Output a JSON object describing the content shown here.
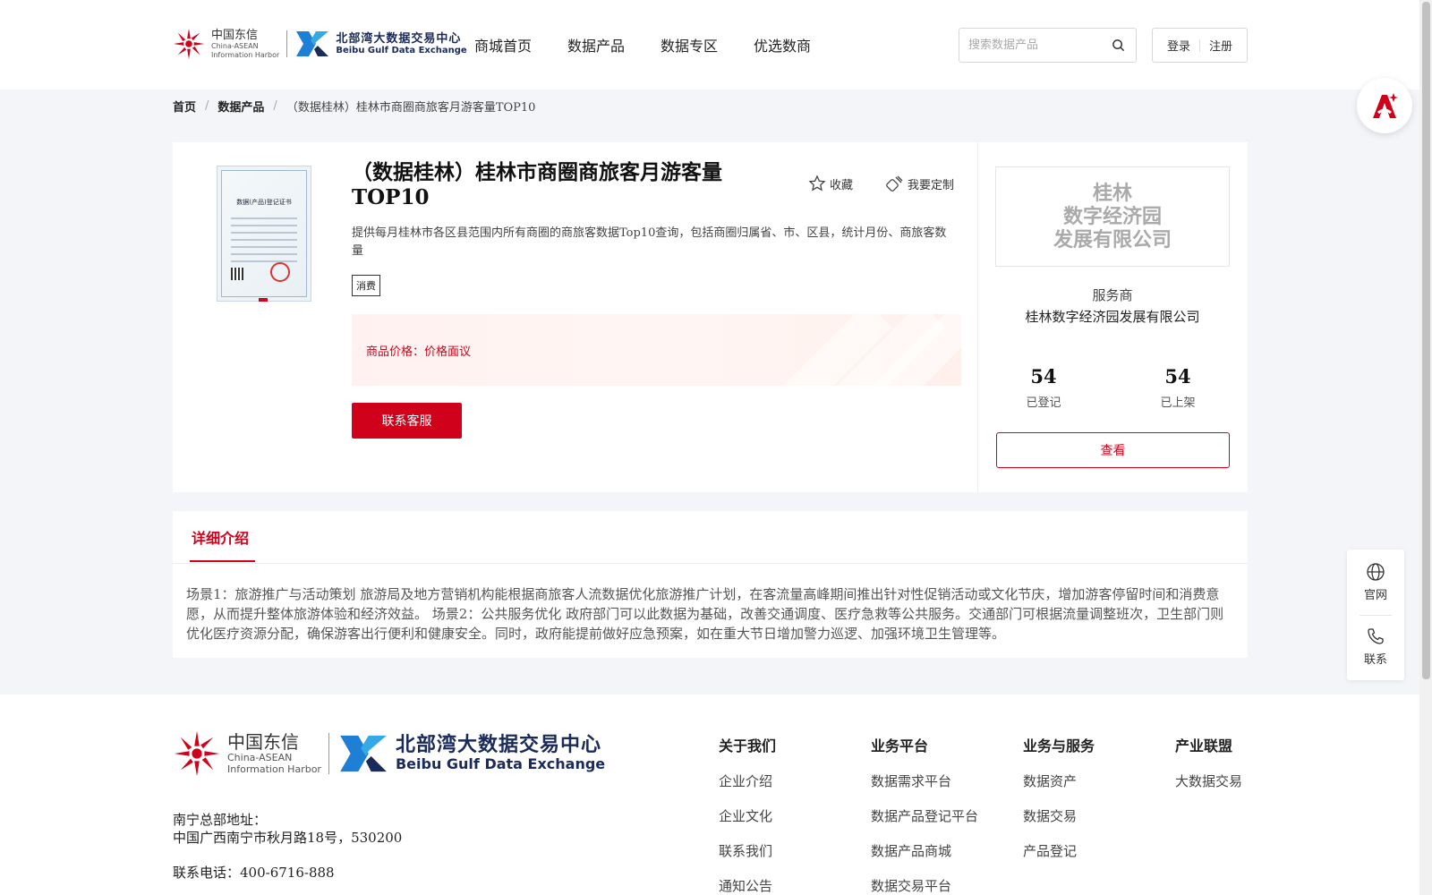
{
  "header": {
    "logo": {
      "cn": "中国东信",
      "en1": "China-ASEAN",
      "en2": "Information Harbor",
      "bb_cn": "北部湾大数据交易中心",
      "bb_en": "Beibu Gulf Data Exchange"
    },
    "nav": [
      "商城首页",
      "数据产品",
      "数据专区",
      "优选数商"
    ],
    "search_placeholder": "搜索数据产品",
    "login": "登录",
    "register": "注册"
  },
  "breadcrumb": {
    "home": "首页",
    "category": "数据产品",
    "current": "（数据桂林）桂林市商圈商旅客月游客量TOP10"
  },
  "product": {
    "title": "（数据桂林）桂林市商圈商旅客月游客量TOP10",
    "favorite": "收藏",
    "customize": "我要定制",
    "description": "提供每月桂林市各区县范围内所有商圈的商旅客数据Top10查询，包括商圈归属省、市、区县，统计月份、商旅客数量",
    "tag": "消费",
    "price_label": "商品价格：",
    "price_value": "价格面议",
    "contact_button": "联系客服",
    "certificate": {
      "title": "数据(产品)登记证书"
    }
  },
  "provider": {
    "logo_lines": [
      "桂林",
      "数字经济园",
      "发展有限公司"
    ],
    "label": "服务商",
    "name": "桂林数字经济园发展有限公司",
    "registered_count": "54",
    "registered_label": "已登记",
    "listed_count": "54",
    "listed_label": "已上架",
    "view_button": "查看"
  },
  "detail": {
    "tab": "详细介绍",
    "text": "场景1：旅游推广与活动策划 旅游局及地方营销机构能根据商旅客人流数据优化旅游推广计划，在客流量高峰期间推出针对性促销活动或文化节庆，增加游客停留时间和消费意愿，从而提升整体旅游体验和经济效益。 场景2：公共服务优化 政府部门可以此数据为基础，改善交通调度、医疗急救等公共服务。交通部门可根据流量调整班次，卫生部门则优化医疗资源分配，确保游客出行便利和健康安全。同时，政府能提前做好应急预案，如在重大节日增加警力巡逻、加强环境卫生管理等。"
  },
  "side_tools": {
    "website": "官网",
    "contact": "联系"
  },
  "footer": {
    "address_label": "南宁总部地址：",
    "address": "中国广西南宁市秋月路18号，530200",
    "phone": "联系电话：400-6716-888",
    "columns": [
      {
        "title": "关于我们",
        "items": [
          "企业介绍",
          "企业文化",
          "联系我们",
          "通知公告"
        ]
      },
      {
        "title": "业务平台",
        "items": [
          "数据需求平台",
          "数据产品登记平台",
          "数据产品商城",
          "数据交易平台"
        ]
      },
      {
        "title": "业务与服务",
        "items": [
          "数据资产",
          "数据交易",
          "产品登记"
        ]
      },
      {
        "title": "产业联盟",
        "items": [
          "大数据交易"
        ]
      }
    ]
  },
  "colors": {
    "accent": "#d0021b",
    "background": "#f4f5f8"
  },
  "icons": {
    "search": "search-icon",
    "favorite": "star-icon",
    "customize": "customize-icon",
    "website": "globe-icon",
    "contact": "phone-icon",
    "ai": "ai-assistant-icon"
  }
}
